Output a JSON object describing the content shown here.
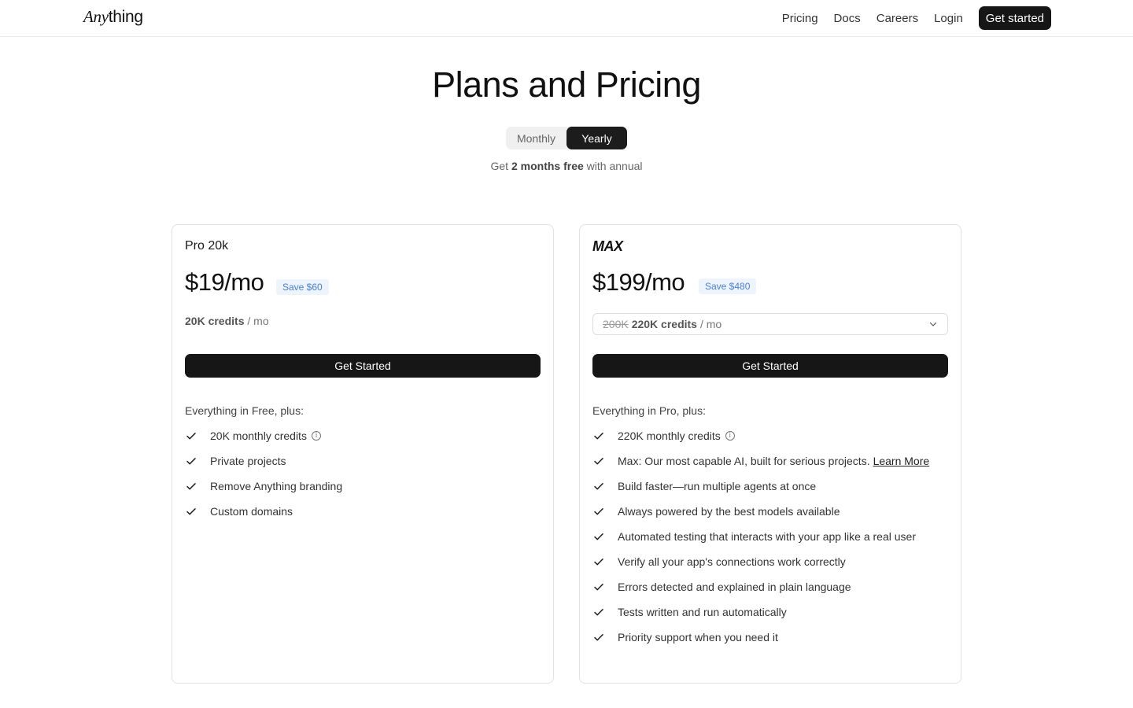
{
  "header": {
    "logo_part1": "Any",
    "logo_part2": "thing",
    "nav": {
      "pricing": "Pricing",
      "docs": "Docs",
      "careers": "Careers",
      "login": "Login",
      "cta": "Get started"
    }
  },
  "hero": {
    "title": "Plans and Pricing",
    "toggle": {
      "monthly": "Monthly",
      "yearly": "Yearly",
      "selected": "Yearly"
    },
    "promo_prefix": "Get",
    "promo_bold": "2 months free",
    "promo_suffix": "with annual"
  },
  "plans": {
    "pro": {
      "name": "Pro 20k",
      "price": "$19/mo",
      "save": "Save $60",
      "credits_bold": "20K credits",
      "credits_unit": "/ mo",
      "button": "Get Started",
      "intro": "Everything in Free, plus:",
      "features": [
        "20K monthly credits",
        "Private projects",
        "Remove Anything branding",
        "Custom domains"
      ]
    },
    "max": {
      "name": "MAX",
      "price": "$199/mo",
      "save": "Save $480",
      "credits_old": "200K",
      "credits_bold": "220K credits",
      "credits_unit": "/ mo",
      "button": "Get Started",
      "intro": "Everything in Pro, plus:",
      "features": [
        "220K monthly credits",
        "Max: Our most capable AI, built for serious projects.",
        "Build faster—run multiple agents at once",
        "Always powered by the best models available",
        "Automated testing that interacts with your app like a real user",
        "Verify all your app's connections work correctly",
        "Errors detected and explained in plain language",
        "Tests written and run automatically",
        "Priority support when you need it"
      ],
      "learn_more": "Learn More"
    }
  },
  "colors": {
    "accent_dark": "#161616",
    "save_badge_bg": "#eef4fc",
    "save_badge_text": "#4a7fd1"
  },
  "icons": {
    "check": "check-icon",
    "info": "info-icon",
    "chevron": "chevron-down-icon"
  }
}
